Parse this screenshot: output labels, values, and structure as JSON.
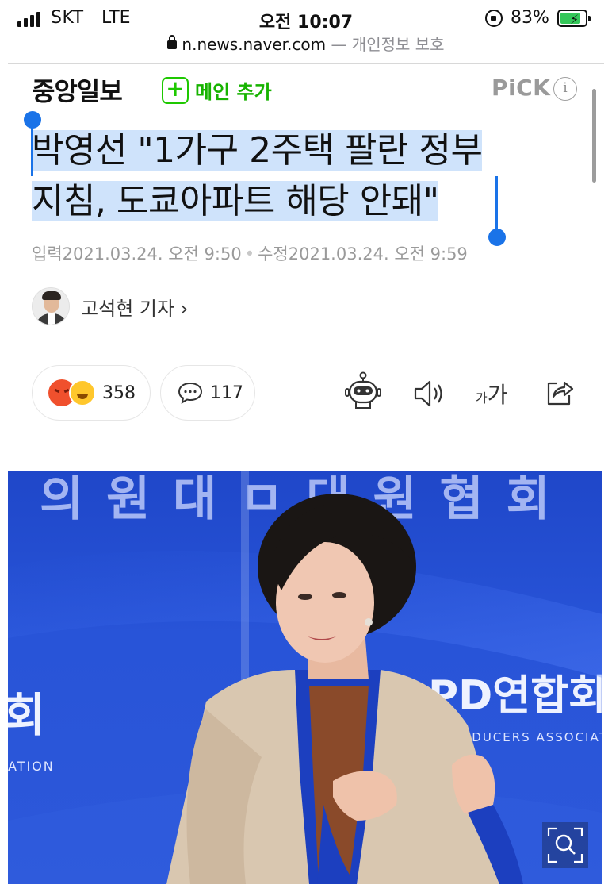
{
  "status_bar": {
    "carrier": "SKT",
    "network": "LTE",
    "time": "오전 10:07",
    "battery_percent": "83%",
    "battery_level": 0.83,
    "icons": [
      "signal-icon",
      "rotation-lock-icon",
      "battery-charging-icon"
    ]
  },
  "address_bar": {
    "domain": "n.news.naver.com",
    "privacy_note": "— 개인정보 보호",
    "icon": "padlock-icon"
  },
  "press": {
    "logo_text": "중앙일보",
    "add_main_label": "메인 추가",
    "add_icon": "+",
    "pick_label": "PiCK",
    "info_icon": "i"
  },
  "article": {
    "headline_line1": "박영선 \"1가구 2주택 팔란 정부",
    "headline_line2": "지침, 도쿄아파트 해당 안돼\"",
    "input_label": "입력",
    "input_date": "2021.03.24. 오전 9:50",
    "separator": "•",
    "edit_label": "수정",
    "edit_date": "2021.03.24. 오전 9:59",
    "reporter": "고석현 기자",
    "reporter_chevron": "›"
  },
  "toolbar": {
    "reaction_count": "358",
    "comment_count": "117",
    "font_small": "가",
    "font_big": "가",
    "icons": [
      "angry-emoji-icon",
      "laugh-emoji-icon",
      "comment-bubble-icon",
      "robot-summary-icon",
      "speaker-icon",
      "font-size-icon",
      "share-icon"
    ]
  },
  "photo": {
    "backdrop_top": "의 원 대 ㅁ 대 원 협 회",
    "backdrop_right": "PD연합회",
    "backdrop_right_sub": "PRODUCERS ASSOCIATION",
    "backdrop_left": "회",
    "backdrop_left_sub": "ATION",
    "zoom_icon": "magnify-icon"
  },
  "colors": {
    "selection": "#cfe3fb",
    "selection_handle": "#1a73e8",
    "naver_green": "#1ec800",
    "meta_gray": "#9a9a9a"
  }
}
